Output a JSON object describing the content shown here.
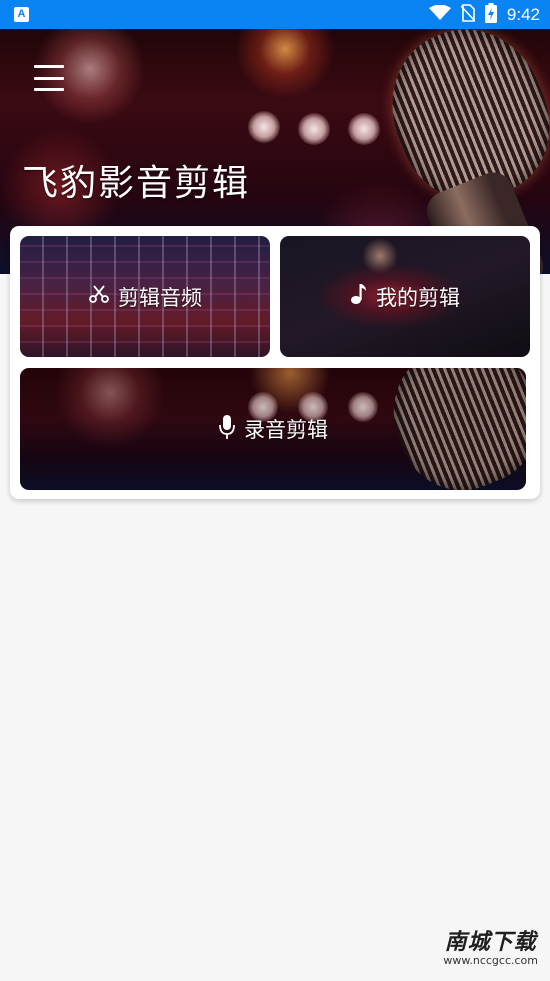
{
  "status_bar": {
    "time": "9:42",
    "app_icon_letter": "A",
    "icons": [
      "wifi-icon",
      "no-sim-icon",
      "battery-charging-icon"
    ],
    "background_color": "#0b84f3"
  },
  "header": {
    "title": "飞豹影音剪辑",
    "menu_icon": "hamburger-menu-icon"
  },
  "tiles": {
    "cut_audio": {
      "label": "剪辑音频",
      "icon": "scissors-icon"
    },
    "my_edits": {
      "label": "我的剪辑",
      "icon": "music-note-icon"
    },
    "record_edit": {
      "label": "录音剪辑",
      "icon": "microphone-icon"
    }
  },
  "watermark": {
    "logo": "南城下载",
    "url": "www.nccgcc.com"
  }
}
